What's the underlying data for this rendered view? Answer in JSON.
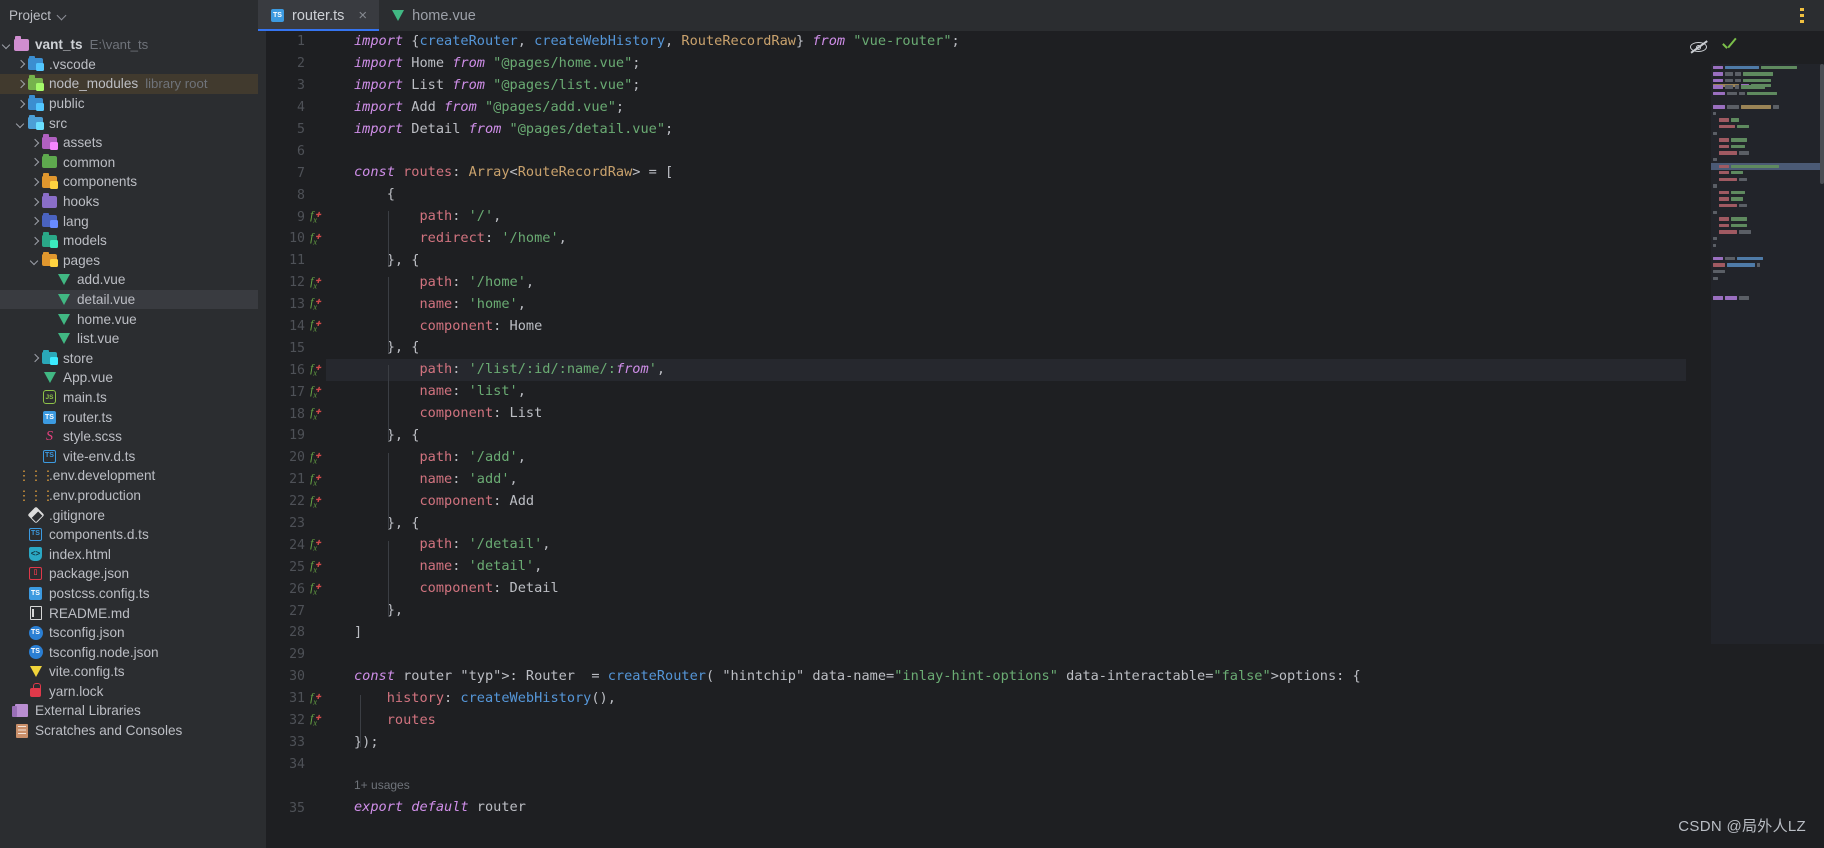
{
  "window": {
    "project_widget_label": "Project",
    "project_widget_icon": "chevron-down-icon",
    "kebab_menu_icon": "more-vertical-icon"
  },
  "tabs": [
    {
      "label": "router.ts",
      "icon": "typescript-file-icon",
      "active": true,
      "closable": true,
      "close_label": "×"
    },
    {
      "label": "home.vue",
      "icon": "vue-file-icon",
      "active": false,
      "closable": false,
      "close_label": ""
    }
  ],
  "sidebar": {
    "items": [
      {
        "label": "vant_ts",
        "hint": "E:\\vant_ts",
        "icon": "folder-icon",
        "icon_color": "#d08ed0",
        "arrow": "open",
        "depth": 0,
        "bold": true,
        "selected": ""
      },
      {
        "label": ".vscode",
        "hint": "",
        "icon": "folder-vscode-icon",
        "icon_color": "#3b8ed0",
        "arrow": "closed",
        "depth": 1,
        "bold": false,
        "selected": ""
      },
      {
        "label": "node_modules",
        "hint": "library root",
        "icon": "folder-node-icon",
        "icon_color": "#76b34c",
        "arrow": "closed",
        "depth": 1,
        "bold": false,
        "selected": "brown"
      },
      {
        "label": "public",
        "hint": "",
        "icon": "folder-public-icon",
        "icon_color": "#3b8ed0",
        "arrow": "closed",
        "depth": 1,
        "bold": false,
        "selected": ""
      },
      {
        "label": "src",
        "hint": "",
        "icon": "folder-source-icon",
        "icon_color": "#4c9fd6",
        "arrow": "open",
        "depth": 1,
        "bold": false,
        "selected": ""
      },
      {
        "label": "assets",
        "hint": "",
        "icon": "folder-assets-icon",
        "icon_color": "#b060c0",
        "arrow": "closed",
        "depth": 2,
        "bold": false,
        "selected": ""
      },
      {
        "label": "common",
        "hint": "",
        "icon": "folder-icon",
        "icon_color": "#5ea94e",
        "arrow": "closed",
        "depth": 2,
        "bold": false,
        "selected": ""
      },
      {
        "label": "components",
        "hint": "",
        "icon": "folder-components-icon",
        "icon_color": "#e0972e",
        "arrow": "closed",
        "depth": 2,
        "bold": false,
        "selected": ""
      },
      {
        "label": "hooks",
        "hint": "",
        "icon": "folder-icon",
        "icon_color": "#8a6ec8",
        "arrow": "closed",
        "depth": 2,
        "bold": false,
        "selected": ""
      },
      {
        "label": "lang",
        "hint": "",
        "icon": "folder-lang-icon",
        "icon_color": "#4a63c0",
        "arrow": "closed",
        "depth": 2,
        "bold": false,
        "selected": ""
      },
      {
        "label": "models",
        "hint": "",
        "icon": "folder-models-icon",
        "icon_color": "#2aa888",
        "arrow": "closed",
        "depth": 2,
        "bold": false,
        "selected": ""
      },
      {
        "label": "pages",
        "hint": "",
        "icon": "folder-pages-icon",
        "icon_color": "#e0972e",
        "arrow": "open",
        "depth": 2,
        "bold": false,
        "selected": ""
      },
      {
        "label": "add.vue",
        "hint": "",
        "icon": "vue-file-icon",
        "icon_color": "#41b883",
        "arrow": "",
        "depth": 3,
        "bold": false,
        "selected": ""
      },
      {
        "label": "detail.vue",
        "hint": "",
        "icon": "vue-file-icon",
        "icon_color": "#41b883",
        "arrow": "",
        "depth": 3,
        "bold": false,
        "selected": "grey"
      },
      {
        "label": "home.vue",
        "hint": "",
        "icon": "vue-file-icon",
        "icon_color": "#41b883",
        "arrow": "",
        "depth": 3,
        "bold": false,
        "selected": ""
      },
      {
        "label": "list.vue",
        "hint": "",
        "icon": "vue-file-icon",
        "icon_color": "#41b883",
        "arrow": "",
        "depth": 3,
        "bold": false,
        "selected": ""
      },
      {
        "label": "store",
        "hint": "",
        "icon": "folder-store-icon",
        "icon_color": "#2aa8b8",
        "arrow": "closed",
        "depth": 2,
        "bold": false,
        "selected": ""
      },
      {
        "label": "App.vue",
        "hint": "",
        "icon": "vue-file-icon",
        "icon_color": "#41b883",
        "arrow": "",
        "depth": 2,
        "bold": false,
        "selected": ""
      },
      {
        "label": "main.ts",
        "hint": "",
        "icon": "javascript-hex-icon",
        "icon_color": "#8dc149",
        "arrow": "",
        "depth": 2,
        "bold": false,
        "selected": ""
      },
      {
        "label": "router.ts",
        "hint": "",
        "icon": "typescript-file-icon",
        "icon_color": "#3c9ae0",
        "arrow": "",
        "depth": 2,
        "bold": false,
        "selected": ""
      },
      {
        "label": "style.scss",
        "hint": "",
        "icon": "sass-file-icon",
        "icon_color": "#e7417f",
        "arrow": "",
        "depth": 2,
        "bold": false,
        "selected": ""
      },
      {
        "label": "vite-env.d.ts",
        "hint": "",
        "icon": "typescript-declaration-icon",
        "icon_color": "#3c9ae0",
        "arrow": "",
        "depth": 2,
        "bold": false,
        "selected": ""
      },
      {
        "label": ".env.development",
        "hint": "",
        "icon": "env-file-icon",
        "icon_color": "#e8a33d",
        "arrow": "",
        "depth": 1,
        "bold": false,
        "selected": ""
      },
      {
        "label": ".env.production",
        "hint": "",
        "icon": "env-file-icon",
        "icon_color": "#e8a33d",
        "arrow": "",
        "depth": 1,
        "bold": false,
        "selected": ""
      },
      {
        "label": ".gitignore",
        "hint": "",
        "icon": "git-file-icon",
        "icon_color": "#dcdcdc",
        "arrow": "",
        "depth": 1,
        "bold": false,
        "selected": ""
      },
      {
        "label": "components.d.ts",
        "hint": "",
        "icon": "typescript-declaration-icon",
        "icon_color": "#3c9ae0",
        "arrow": "",
        "depth": 1,
        "bold": false,
        "selected": ""
      },
      {
        "label": "index.html",
        "hint": "",
        "icon": "html-file-icon",
        "icon_color": "#2aa8c4",
        "arrow": "",
        "depth": 1,
        "bold": false,
        "selected": ""
      },
      {
        "label": "package.json",
        "hint": "",
        "icon": "npm-file-icon",
        "icon_color": "#e0394a",
        "arrow": "",
        "depth": 1,
        "bold": false,
        "selected": ""
      },
      {
        "label": "postcss.config.ts",
        "hint": "",
        "icon": "typescript-file-icon",
        "icon_color": "#3c9ae0",
        "arrow": "",
        "depth": 1,
        "bold": false,
        "selected": ""
      },
      {
        "label": "README.md",
        "hint": "",
        "icon": "markdown-file-icon",
        "icon_color": "#d6d6d6",
        "arrow": "",
        "depth": 1,
        "bold": false,
        "selected": ""
      },
      {
        "label": "tsconfig.json",
        "hint": "",
        "icon": "tsconfig-file-icon",
        "icon_color": "#2a7fd4",
        "arrow": "",
        "depth": 1,
        "bold": false,
        "selected": ""
      },
      {
        "label": "tsconfig.node.json",
        "hint": "",
        "icon": "tsconfig-file-icon",
        "icon_color": "#2a7fd4",
        "arrow": "",
        "depth": 1,
        "bold": false,
        "selected": ""
      },
      {
        "label": "vite.config.ts",
        "hint": "",
        "icon": "vite-file-icon",
        "icon_color": "#f0d43a",
        "arrow": "",
        "depth": 1,
        "bold": false,
        "selected": ""
      },
      {
        "label": "yarn.lock",
        "hint": "",
        "icon": "lock-file-icon",
        "icon_color": "#e0394a",
        "arrow": "",
        "depth": 1,
        "bold": false,
        "selected": ""
      },
      {
        "label": "External Libraries",
        "hint": "",
        "icon": "external-libraries-icon",
        "icon_color": "#b98ed1",
        "arrow": "",
        "depth": 0,
        "bold": false,
        "selected": "",
        "label_style": "blue"
      },
      {
        "label": "Scratches and Consoles",
        "hint": "",
        "icon": "scratches-icon",
        "icon_color": "#c98f6a",
        "arrow": "",
        "depth": 0,
        "bold": false,
        "selected": "",
        "label_style": "blue"
      }
    ]
  },
  "editor": {
    "filename": "router.ts",
    "current_line": 16,
    "usages_hint": {
      "line_before": 35,
      "text": "1+ usages"
    },
    "inlay_hints": {
      "options_chip": "options:",
      "router_type": ": Router"
    },
    "inspection_icons": [
      {
        "name": "inspections-off-icon",
        "tooltip": ""
      },
      {
        "name": "no-problems-check-icon",
        "tooltip": ""
      }
    ],
    "lines": [
      {
        "n": 1,
        "fx": false,
        "text": "import {createRouter, createWebHistory, RouteRecordRaw} from \"vue-router\";"
      },
      {
        "n": 2,
        "fx": false,
        "text": "import Home from \"@pages/home.vue\";"
      },
      {
        "n": 3,
        "fx": false,
        "text": "import List from \"@pages/list.vue\";"
      },
      {
        "n": 4,
        "fx": false,
        "text": "import Add from \"@pages/add.vue\";"
      },
      {
        "n": 5,
        "fx": false,
        "text": "import Detail from \"@pages/detail.vue\";"
      },
      {
        "n": 6,
        "fx": false,
        "text": ""
      },
      {
        "n": 7,
        "fx": false,
        "text": "const routes: Array<RouteRecordRaw> = ["
      },
      {
        "n": 8,
        "fx": false,
        "text": "    {"
      },
      {
        "n": 9,
        "fx": true,
        "text": "        path: '/',"
      },
      {
        "n": 10,
        "fx": true,
        "text": "        redirect: '/home',"
      },
      {
        "n": 11,
        "fx": false,
        "text": "    }, {"
      },
      {
        "n": 12,
        "fx": true,
        "text": "        path: '/home',"
      },
      {
        "n": 13,
        "fx": true,
        "text": "        name: 'home',"
      },
      {
        "n": 14,
        "fx": true,
        "text": "        component: Home"
      },
      {
        "n": 15,
        "fx": false,
        "text": "    }, {"
      },
      {
        "n": 16,
        "fx": true,
        "text": "        path: '/list/:id/:name/:from',"
      },
      {
        "n": 17,
        "fx": true,
        "text": "        name: 'list',"
      },
      {
        "n": 18,
        "fx": true,
        "text": "        component: List"
      },
      {
        "n": 19,
        "fx": false,
        "text": "    }, {"
      },
      {
        "n": 20,
        "fx": true,
        "text": "        path: '/add',"
      },
      {
        "n": 21,
        "fx": true,
        "text": "        name: 'add',"
      },
      {
        "n": 22,
        "fx": true,
        "text": "        component: Add"
      },
      {
        "n": 23,
        "fx": false,
        "text": "    }, {"
      },
      {
        "n": 24,
        "fx": true,
        "text": "        path: '/detail',"
      },
      {
        "n": 25,
        "fx": true,
        "text": "        name: 'detail',"
      },
      {
        "n": 26,
        "fx": true,
        "text": "        component: Detail"
      },
      {
        "n": 27,
        "fx": false,
        "text": "    },"
      },
      {
        "n": 28,
        "fx": false,
        "text": "]"
      },
      {
        "n": 29,
        "fx": false,
        "text": ""
      },
      {
        "n": 30,
        "fx": false,
        "text": "const router : Router  = createRouter( options: {"
      },
      {
        "n": 31,
        "fx": true,
        "text": "    history: createWebHistory(),"
      },
      {
        "n": 32,
        "fx": true,
        "text": "    routes"
      },
      {
        "n": 33,
        "fx": false,
        "text": "});"
      },
      {
        "n": 34,
        "fx": false,
        "text": ""
      },
      {
        "n": 35,
        "fx": false,
        "text": "export default router"
      }
    ]
  },
  "watermark": {
    "text": "CSDN @局外人LZ"
  },
  "colors": {
    "accent": "#3574f0",
    "editor_bg": "#1e1f22",
    "panel_bg": "#2b2d30",
    "keyword": "#cf8ee8",
    "string": "#6aab73",
    "property": "#d1737f",
    "function": "#5596d8",
    "class": "#c9a26d",
    "current_line_bg": "#26282e",
    "selection_brown": "#413a2e",
    "selection_grey": "#393b40"
  }
}
